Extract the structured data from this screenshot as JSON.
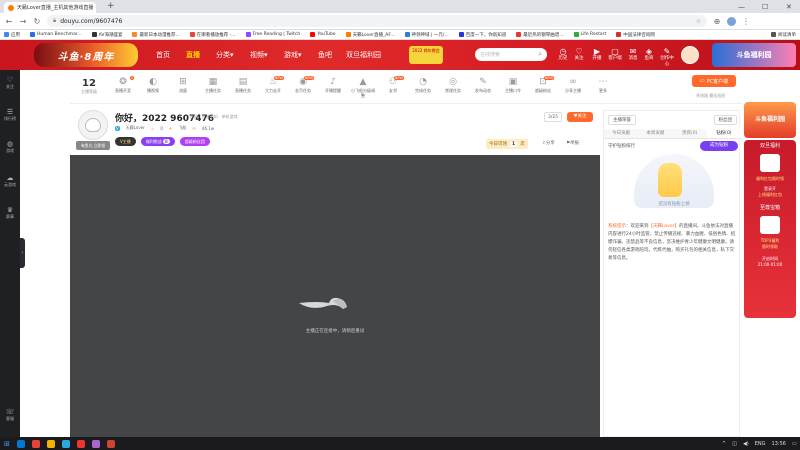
{
  "browser": {
    "tab_title": "天籁Lover直播_主机其他游戏直播",
    "new_tab": "+",
    "url": "douyu.com/9607476",
    "window_controls": [
      "—",
      "☐",
      "✕"
    ],
    "bookmarks": [
      {
        "label": "应用",
        "color": "#4285f4"
      },
      {
        "label": "Human Benchmar...",
        "color": "#2b6de6"
      },
      {
        "label": "AV海潮盛宴",
        "color": "#333"
      },
      {
        "label": "最新日本动漫推荐...",
        "color": "#f28b2a"
      },
      {
        "label": "在哪看播放推荐 -...",
        "color": "#e43"
      },
      {
        "label": "Free Reading | Twitch",
        "color": "#9146ff"
      },
      {
        "label": "YouTube",
        "color": "#f00"
      },
      {
        "label": "天籁Lover直播_AF...",
        "color": "#ff7a00"
      },
      {
        "label": "神领神域 | 一元/...",
        "color": "#2a7de1"
      },
      {
        "label": "百度一下，你就知道",
        "color": "#2932e1"
      },
      {
        "label": "最近热的钢琴曲谱...",
        "color": "#e33"
      },
      {
        "label": "Life Restart",
        "color": "#3a3"
      },
      {
        "label": "中国法律咨询网",
        "color": "#c33"
      },
      {
        "label": "阅读清单",
        "color": "#555"
      }
    ]
  },
  "header": {
    "logo": "斗鱼·8周年",
    "nav": [
      "首页",
      "直播",
      "分类",
      "视频",
      "游戏",
      "鱼吧",
      "双旦福利园"
    ],
    "nav_arrows": [
      "▾",
      "▾",
      "▾"
    ],
    "promo": "2022 跨年晚会",
    "search_placeholder": "在线搜索",
    "search_icon": "⌕",
    "icons": [
      {
        "label": "历史",
        "glyph": "◷"
      },
      {
        "label": "关注",
        "glyph": "♡"
      },
      {
        "label": "开播",
        "glyph": "▶"
      },
      {
        "label": "客户端",
        "glyph": "▢"
      },
      {
        "label": "消息",
        "glyph": "✉"
      },
      {
        "label": "鱼商",
        "glyph": "◈"
      },
      {
        "label": "创作中心",
        "glyph": "✎"
      }
    ],
    "banner": "斗鱼福利园"
  },
  "sidebar": [
    {
      "label": "关注",
      "glyph": "♡"
    },
    {
      "label": "排行榜",
      "glyph": "☰"
    },
    {
      "label": "游戏",
      "glyph": "◍"
    },
    {
      "label": "云游戏",
      "glyph": "☁"
    },
    {
      "label": "赛事",
      "glyph": "♛"
    },
    {
      "label": "客服",
      "glyph": "☏"
    }
  ],
  "sidebar_handle": "›",
  "toolbar": {
    "level": "12",
    "level_label": "主播等级",
    "items": [
      {
        "label": "直播开奖",
        "glyph": "❂",
        "badge": "1"
      },
      {
        "label": "播视频",
        "glyph": "◐",
        "badge": ""
      },
      {
        "label": "流量",
        "glyph": "⊞",
        "badge": ""
      },
      {
        "label": "主播任务",
        "glyph": "▦",
        "badge": ""
      },
      {
        "label": "直播任务",
        "glyph": "▤",
        "badge": ""
      },
      {
        "label": "大力去开",
        "glyph": "♨",
        "badge": "NEW"
      },
      {
        "label": "金币任务",
        "glyph": "◉",
        "badge": "NEW"
      },
      {
        "label": "开播提醒",
        "glyph": "♪",
        "badge": ""
      },
      {
        "label": "小飞船分级调整",
        "glyph": "▲",
        "badge": ""
      },
      {
        "label": "友邻",
        "glyph": "⚇",
        "badge": "NEW"
      },
      {
        "label": "完成任务",
        "glyph": "◔",
        "badge": ""
      },
      {
        "label": "常规任务",
        "glyph": "◎",
        "badge": ""
      },
      {
        "label": "发布动态",
        "glyph": "✎",
        "badge": ""
      },
      {
        "label": "主播口令",
        "glyph": "▣",
        "badge": ""
      },
      {
        "label": "超级粉丝",
        "glyph": "⊡",
        "badge": "NEW"
      },
      {
        "label": "分享主播",
        "glyph": "∞",
        "badge": ""
      },
      {
        "label": "更多",
        "glyph": "⋯",
        "badge": ""
      }
    ],
    "pc_button": "PC客户端",
    "pc_sub": "多线路 最佳画质"
  },
  "room": {
    "avatar_button": "有鱼丸 立即领",
    "title": "你好，2022 9607476",
    "category": "房间 · 其他主机 · 单机游戏",
    "streamer": "天籁Lover",
    "hot": "0",
    "fans": "飞船",
    "follows": "46.1w",
    "badge_v": "V主播",
    "tag1": "福利挑战",
    "tag1_count": "8",
    "tag2": "超级粉丝团",
    "rank": "3/25",
    "follow_btn": "关注",
    "today_label": "今日可领",
    "today_count": "1",
    "today_unit": "次",
    "share": "分享",
    "report": "举报"
  },
  "player": {
    "status": "主播正在连接中，请稍后重试"
  },
  "right": {
    "btn1": "主播荣誉",
    "btn2": "粉丝团",
    "tabs": [
      "今日贡献",
      "本周贡献",
      "贵宾(0)",
      "钻粉(0)"
    ],
    "guard_title": "守护钻粉排行",
    "open_guard": "成为钻粉",
    "illus_text": "还没有钻粉上榜",
    "sys_label": "系统提示",
    "sys_prefix": "：欢迎来到",
    "sys_name": "【天籁Lover】",
    "sys_body": "的直播间。斗鱼依法对直播内容进行24小时监管，禁止传播违规、暴力血腥、低俗色情、招嫖诈骗、违禁品等不良信息，坚决维护青少年健康文明健康。请勿轻信各类游戏陪玩，代练代抽，购买礼包的相关信息，私下交易等信息。"
  },
  "ads": {
    "top": "斗鱼福利园",
    "side_text1": "双旦福利",
    "side_text2": "福利红包限时领",
    "side_text3": "登录开",
    "side_text4": "上线福利红包",
    "side_text5": "至尊宝箱",
    "side_text6": "TOP3福利",
    "side_text7": "限时领取",
    "side_text8": "开启时间",
    "side_text9": "21:00-01:00"
  },
  "taskbar": {
    "lang": "ENG",
    "time": "13:56",
    "apps": [
      "#0078d4",
      "#ea4335",
      "#f4b400",
      "#2aa8e0",
      "#e33",
      "#aa66cc",
      "#c43"
    ]
  }
}
